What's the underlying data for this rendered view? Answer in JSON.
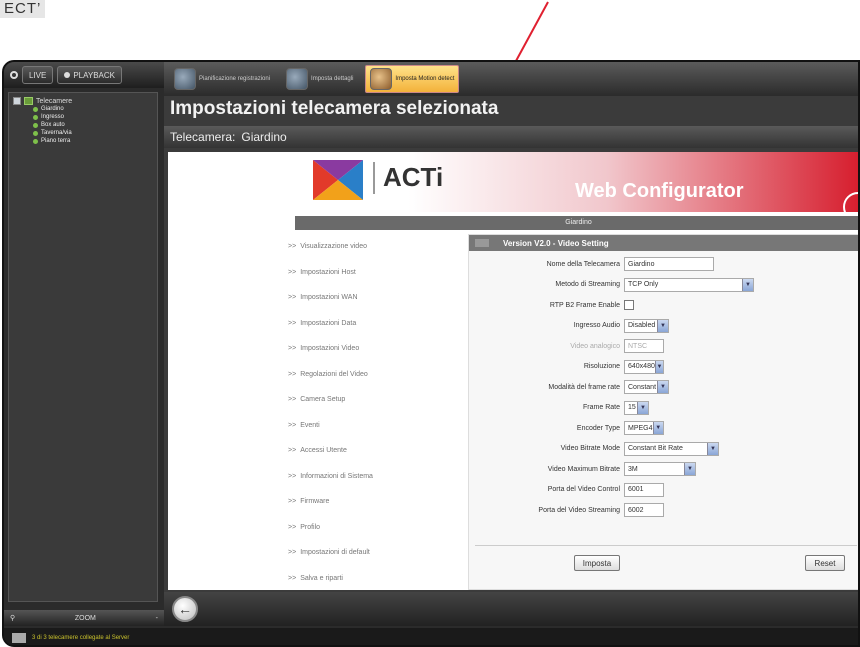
{
  "doc_heading": "ECT’",
  "left_panel": {
    "live_label": "LIVE",
    "playback_label": "PLAYBACK",
    "tree_root": "Telecamere",
    "cameras": [
      "Giardino",
      "Ingresso",
      "Box auto",
      "Taverna/via",
      "Piano terra"
    ],
    "zoom_label": "ZOOM",
    "zoom_minus": "-"
  },
  "toolbar": {
    "items": [
      {
        "label": "Pianificazione registrazioni"
      },
      {
        "label": "Imposta dettagli"
      },
      {
        "label": "Imposta Motion detect"
      }
    ]
  },
  "page_title": "Impostazioni telecamera selezionata",
  "camera_line": {
    "label": "Telecamera:",
    "value": "Giardino"
  },
  "web_configurator": {
    "brand": "ACTi",
    "title": "Web Configurator",
    "camera_header": "Giardino"
  },
  "menu": {
    "prefix": ">>",
    "items": [
      "Visualizzazione video",
      "Impostazioni Host",
      "Impostazioni WAN",
      "Impostazioni Data",
      "Impostazioni Video",
      "Regolazioni del Video",
      "Camera Setup",
      "Eventi",
      "Accessi Utente",
      "Informazioni di Sistema",
      "Firmware",
      "Profilo",
      "Impostazioni di default",
      "Salva e riparti"
    ]
  },
  "form": {
    "header": "Version V2.0 - Video Setting",
    "rows": [
      {
        "label": "Nome della Telecamera",
        "value": "Giardino",
        "type": "input"
      },
      {
        "label": "Metodo di Streaming",
        "value": "TCP Only",
        "type": "select"
      },
      {
        "label": "RTP B2 Frame Enable",
        "value": "",
        "type": "checkbox"
      },
      {
        "label": "Ingresso Audio",
        "value": "Disabled",
        "type": "select"
      },
      {
        "label": "Video analogico",
        "value": "NTSC",
        "type": "input-disabled"
      },
      {
        "label": "Risoluzione",
        "value": "640x480",
        "type": "select"
      },
      {
        "label": "Modalità del frame rate",
        "value": "Constant",
        "type": "select"
      },
      {
        "label": "Frame Rate",
        "value": "15",
        "type": "select"
      },
      {
        "label": "Encoder Type",
        "value": "MPEG4",
        "type": "select"
      },
      {
        "label": "Video Bitrate Mode",
        "value": "Constant Bit Rate",
        "type": "select"
      },
      {
        "label": "Video Maximum Bitrate",
        "value": "3M",
        "type": "select"
      },
      {
        "label": "Porta del Video Control",
        "value": "6001",
        "type": "input"
      },
      {
        "label": "Porta del Video Streaming",
        "value": "6002",
        "type": "input"
      }
    ],
    "submit_label": "Imposta",
    "reset_label": "Reset"
  },
  "status_bar": {
    "text": "3 di 3 telecamere collegate al Server"
  },
  "colors": {
    "accent_red": "#d61c2c",
    "active_tool": "#f3b23a",
    "status_text": "#c9c12c"
  }
}
